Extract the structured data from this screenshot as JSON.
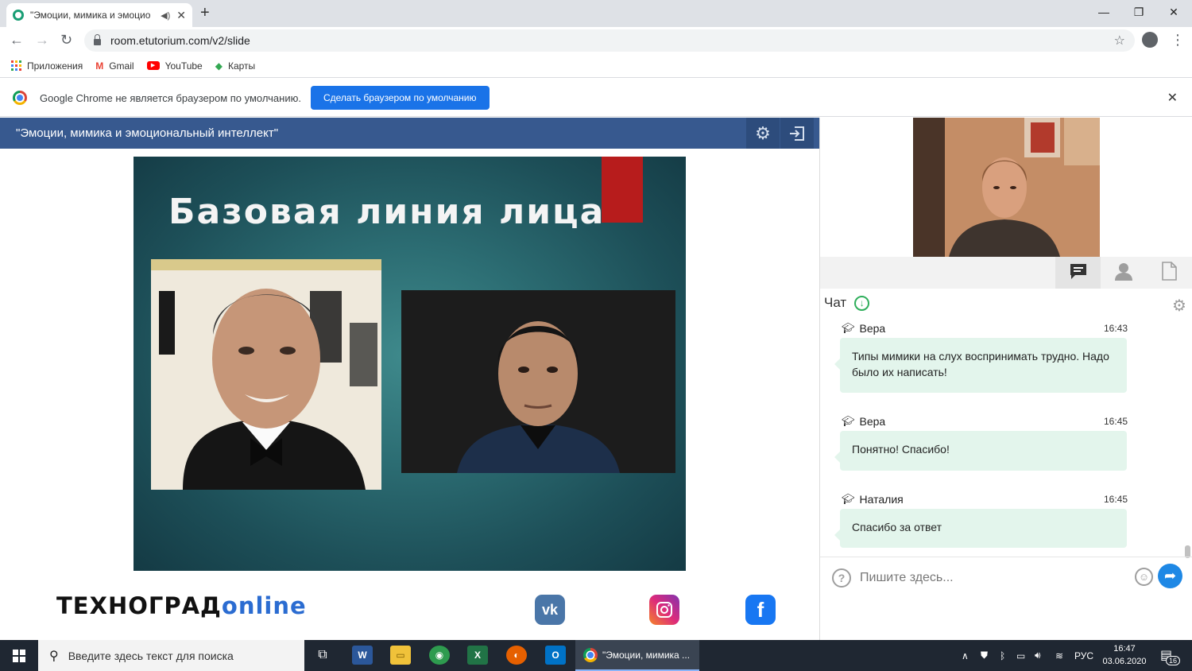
{
  "browser": {
    "tab_title": "\"Эмоции, мимика и эмоцио",
    "url": "room.etutorium.com/v2/slide",
    "bookmarks": [
      {
        "label": "Приложения",
        "icon": "apps-grid-icon"
      },
      {
        "label": "Gmail",
        "icon": "gmail-icon"
      },
      {
        "label": "YouTube",
        "icon": "youtube-icon"
      },
      {
        "label": "Карты",
        "icon": "maps-icon"
      }
    ],
    "infobar": {
      "message": "Google Chrome не является браузером по умолчанию.",
      "button": "Сделать браузером по умолчанию"
    }
  },
  "app": {
    "title": "\"Эмоции, мимика и эмоциональный интеллект\""
  },
  "slide": {
    "title": "Базовая линия лица",
    "accent_color": "#b71c1c"
  },
  "footer": {
    "brand": "ТЕХНОГРАД",
    "brand_suffix": "online",
    "social": [
      {
        "name": "vk-icon",
        "color": "#4a76a8"
      },
      {
        "name": "instagram-icon",
        "color": "#d6249f"
      },
      {
        "name": "facebook-icon",
        "color": "#1877f2"
      }
    ]
  },
  "chat": {
    "title": "Чат",
    "messages": [
      {
        "author": "Вера",
        "time": "16:43",
        "text": "Типы мимики на слух воспринимать трудно. Надо было их написать!"
      },
      {
        "author": "Вера",
        "time": "16:45",
        "text": "Понятно! Спасибо!"
      },
      {
        "author": "Наталия",
        "time": "16:45",
        "text": "Спасибо за ответ"
      }
    ],
    "input_placeholder": "Пишите здесь..."
  },
  "taskbar": {
    "search_placeholder": "Введите здесь текст для поиска",
    "active_window": "\"Эмоции, мимика ...",
    "language": "РУС",
    "time": "16:47",
    "date": "03.06.2020",
    "notifications": "16"
  }
}
